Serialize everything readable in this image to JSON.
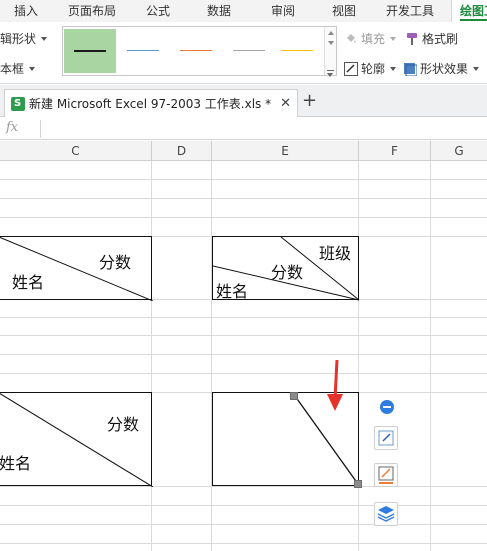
{
  "ribbon_tabs": [
    "插入",
    "页面布局",
    "公式",
    "数据",
    "审阅",
    "视图",
    "开发工具",
    "绘图工"
  ],
  "active_tab": "绘图工",
  "ribbon": {
    "edit_shape": "辑形状",
    "text_box": "本框",
    "fill": "填充",
    "format_painter": "格式刷",
    "outline": "轮廓",
    "shape_effects": "形状效果",
    "line_styles": [
      {
        "name": "black",
        "color": "#1a1a1a",
        "selected": true
      },
      {
        "name": "blue",
        "color": "#5b9bd5",
        "selected": false
      },
      {
        "name": "orange",
        "color": "#ed7d31",
        "selected": false
      },
      {
        "name": "gray",
        "color": "#a5a5a5",
        "selected": false
      },
      {
        "name": "gold",
        "color": "#ffc000",
        "selected": false
      }
    ]
  },
  "document_tab": {
    "title": "新建 Microsoft Excel 97-2003 工作表.xls *",
    "close": "✕",
    "new_tab": "+"
  },
  "formula_bar": {
    "fx": "fx",
    "value": ""
  },
  "columns": [
    "C",
    "D",
    "E",
    "F",
    "G"
  ],
  "cells": {
    "c1_top_right": "分数",
    "c1_bottom_left": "姓名",
    "e1_top_right": "班级",
    "e1_middle": "分数",
    "e1_bottom_left": "姓名",
    "c2_top_right": "分数",
    "c2_bottom_left": "姓名"
  },
  "colors": {
    "accent": "#1e8a3e",
    "arrow": "#e8312a",
    "selected_swatch": "#a8d5a2"
  }
}
